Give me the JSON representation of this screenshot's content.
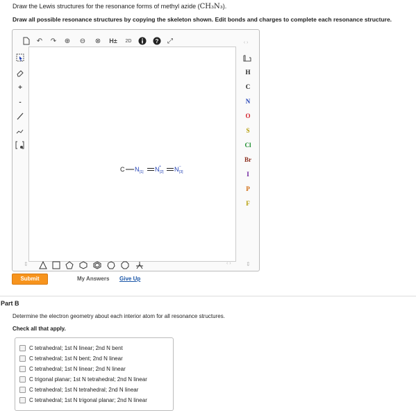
{
  "question": {
    "text_prefix": "Draw the Lewis structures for the resonance forms of methyl azide (",
    "formula": "CH₃N₃",
    "text_suffix": ").",
    "instruction": "Draw all possible resonance structures by copying the skeleton shown. Edit bonds and charges to complete each resonance structure."
  },
  "toolbar": {
    "h_toggle": "H±",
    "label_2d": "2D",
    "help": "?"
  },
  "elements": [
    "H",
    "C",
    "N",
    "O",
    "S",
    "Cl",
    "Br",
    "I",
    "P",
    "F"
  ],
  "element_colors": {
    "H": "#222",
    "C": "#222",
    "N": "#1f3fb5",
    "O": "#d2202a",
    "S": "#b39a00",
    "Cl": "#1a8c2b",
    "Br": "#8a2a1a",
    "I": "#6a1a9a",
    "P": "#d06a10",
    "F": "#b39a00"
  },
  "skeleton": {
    "c": "C",
    "n1": "N",
    "n1_idx": "[1]",
    "n2": "N",
    "n2_idx": "[2]",
    "n3": "N",
    "n3_idx": "[3]",
    "plus": "+",
    "minus": "−"
  },
  "actions": {
    "submit": "Submit",
    "my_answers": "My Answers",
    "give_up": "Give Up"
  },
  "part_b": {
    "title": "Part B",
    "prompt": "Determine the electron geometry about each interior atom for all resonance structures.",
    "check_all": "Check all that apply.",
    "options": [
      "C tetrahedral; 1st N linear; 2nd N bent",
      "C tetrahedral; 1st N bent; 2nd N linear",
      "C tetrahedral; 1st N linear; 2nd N linear",
      "C trigonal planar; 1st N tetrahedral; 2nd N linear",
      "C tetrahedral; 1st N tetrahedral; 2nd N linear",
      "C tetrahedral; 1st N trigonal planar; 2nd N linear"
    ]
  }
}
